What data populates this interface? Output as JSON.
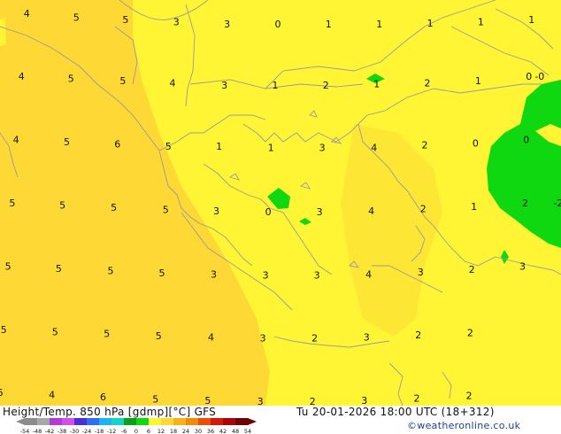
{
  "map": {
    "colors": {
      "warm_yellow": "#fed936",
      "yellow": "#fff534",
      "green": "#10d810",
      "border": "#9b9b9b"
    },
    "temperature_labels": [
      {
        "value": "4",
        "lon": 20.05,
        "lat": 44.2
      },
      {
        "value": "5",
        "lon": 20.98,
        "lat": 44.1
      },
      {
        "value": "5",
        "lon": 21.9,
        "lat": 44.05
      },
      {
        "value": "3",
        "lon": 22.85,
        "lat": 44.0
      },
      {
        "value": "3",
        "lon": 23.8,
        "lat": 43.95
      },
      {
        "value": "0",
        "lon": 24.75,
        "lat": 43.95
      },
      {
        "value": "1",
        "lon": 25.7,
        "lat": 43.95
      },
      {
        "value": "1",
        "lon": 26.65,
        "lat": 43.95
      },
      {
        "value": "1",
        "lon": 27.6,
        "lat": 43.97
      },
      {
        "value": "1",
        "lon": 28.55,
        "lat": 44.0
      },
      {
        "value": "1",
        "lon": 29.5,
        "lat": 44.05
      },
      {
        "value": "4",
        "lon": 19.95,
        "lat": 42.75
      },
      {
        "value": "5",
        "lon": 20.88,
        "lat": 42.7
      },
      {
        "value": "5",
        "lon": 21.85,
        "lat": 42.65
      },
      {
        "value": "4",
        "lon": 22.78,
        "lat": 42.6
      },
      {
        "value": "3",
        "lon": 23.75,
        "lat": 42.55
      },
      {
        "value": "1",
        "lon": 24.7,
        "lat": 42.55
      },
      {
        "value": "2",
        "lon": 25.65,
        "lat": 42.55
      },
      {
        "value": "1",
        "lon": 26.6,
        "lat": 42.58
      },
      {
        "value": "2",
        "lon": 27.55,
        "lat": 42.6
      },
      {
        "value": "1",
        "lon": 28.5,
        "lat": 42.65
      },
      {
        "value": "0",
        "lon": 29.45,
        "lat": 42.75
      },
      {
        "value": "4",
        "lon": 19.85,
        "lat": 41.3
      },
      {
        "value": "5",
        "lon": 20.8,
        "lat": 41.25
      },
      {
        "value": "6",
        "lon": 21.75,
        "lat": 41.2
      },
      {
        "value": "5",
        "lon": 22.7,
        "lat": 41.15
      },
      {
        "value": "1",
        "lon": 23.65,
        "lat": 41.15
      },
      {
        "value": "1",
        "lon": 24.62,
        "lat": 41.12
      },
      {
        "value": "3",
        "lon": 25.58,
        "lat": 41.12
      },
      {
        "value": "4",
        "lon": 26.55,
        "lat": 41.12
      },
      {
        "value": "2",
        "lon": 27.5,
        "lat": 41.18
      },
      {
        "value": "0",
        "lon": 28.45,
        "lat": 41.22
      },
      {
        "value": "0",
        "lon": 29.4,
        "lat": 41.3
      },
      {
        "value": "5",
        "lon": 19.78,
        "lat": 39.85
      },
      {
        "value": "5",
        "lon": 20.72,
        "lat": 39.8
      },
      {
        "value": "5",
        "lon": 21.68,
        "lat": 39.75
      },
      {
        "value": "5",
        "lon": 22.65,
        "lat": 39.7
      },
      {
        "value": "3",
        "lon": 23.6,
        "lat": 39.67
      },
      {
        "value": "0",
        "lon": 24.57,
        "lat": 39.65
      },
      {
        "value": "3",
        "lon": 25.53,
        "lat": 39.65
      },
      {
        "value": "4",
        "lon": 26.5,
        "lat": 39.67
      },
      {
        "value": "2",
        "lon": 27.47,
        "lat": 39.72
      },
      {
        "value": "1",
        "lon": 28.42,
        "lat": 39.77
      },
      {
        "value": "2",
        "lon": 29.38,
        "lat": 39.85
      },
      {
        "value": "5",
        "lon": 19.7,
        "lat": 38.4
      },
      {
        "value": "5",
        "lon": 20.65,
        "lat": 38.35
      },
      {
        "value": "5",
        "lon": 21.62,
        "lat": 38.3
      },
      {
        "value": "5",
        "lon": 22.58,
        "lat": 38.25
      },
      {
        "value": "3",
        "lon": 23.55,
        "lat": 38.22
      },
      {
        "value": "3",
        "lon": 24.52,
        "lat": 38.2
      },
      {
        "value": "3",
        "lon": 25.48,
        "lat": 38.2
      },
      {
        "value": "4",
        "lon": 26.45,
        "lat": 38.22
      },
      {
        "value": "3",
        "lon": 27.42,
        "lat": 38.27
      },
      {
        "value": "2",
        "lon": 28.38,
        "lat": 38.33
      },
      {
        "value": "3",
        "lon": 29.33,
        "lat": 38.4
      },
      {
        "value": "5",
        "lon": 19.62,
        "lat": 36.95
      },
      {
        "value": "5",
        "lon": 20.58,
        "lat": 36.9
      },
      {
        "value": "5",
        "lon": 21.55,
        "lat": 36.85
      },
      {
        "value": "5",
        "lon": 22.52,
        "lat": 36.8
      },
      {
        "value": "4",
        "lon": 23.5,
        "lat": 36.77
      },
      {
        "value": "3",
        "lon": 24.47,
        "lat": 36.75
      },
      {
        "value": "2",
        "lon": 25.44,
        "lat": 36.75
      },
      {
        "value": "3",
        "lon": 26.41,
        "lat": 36.77
      },
      {
        "value": "2",
        "lon": 27.38,
        "lat": 36.82
      },
      {
        "value": "2",
        "lon": 28.35,
        "lat": 36.88
      },
      {
        "value": "6",
        "lon": 19.55,
        "lat": 35.5
      },
      {
        "value": "4",
        "lon": 20.52,
        "lat": 35.45
      },
      {
        "value": "6",
        "lon": 21.48,
        "lat": 35.4
      },
      {
        "value": "5",
        "lon": 22.46,
        "lat": 35.35
      },
      {
        "value": "5",
        "lon": 23.44,
        "lat": 35.32
      },
      {
        "value": "3",
        "lon": 24.42,
        "lat": 35.3
      },
      {
        "value": "2",
        "lon": 25.4,
        "lat": 35.3
      },
      {
        "value": "3",
        "lon": 26.37,
        "lat": 35.32
      },
      {
        "value": "2",
        "lon": 27.35,
        "lat": 35.37
      },
      {
        "value": "2",
        "lon": 28.33,
        "lat": 35.43
      }
    ],
    "partial_labels": [
      {
        "value": "-0",
        "lon": 29.45,
        "lat": 42.75
      },
      {
        "value": "-2",
        "lon": 29.8,
        "lat": 39.85
      }
    ]
  },
  "footer": {
    "title": "Height/Temp. 850 hPa [gdmp][°C] GFS",
    "datetime": "Tu 20-01-2026 18:00 UTC (18+312)",
    "credit": "©weatheronline.co.uk"
  },
  "scale": {
    "ticks": [
      "-54",
      "-48",
      "-42",
      "-38",
      "-30",
      "-24",
      "-18",
      "-12",
      "-6",
      "0",
      "6",
      "12",
      "18",
      "24",
      "30",
      "36",
      "42",
      "48",
      "54"
    ],
    "colors": [
      "#8c8c8c",
      "#a8a8a8",
      "#b23bd6",
      "#d44fe6",
      "#4a2fd8",
      "#2d6ff0",
      "#1fb1f0",
      "#15d4c8",
      "#0aa01a",
      "#10d810",
      "#fff534",
      "#fed936",
      "#f7b21c",
      "#f08a0a",
      "#e8500a",
      "#d11a0a",
      "#a8070a",
      "#6d0506"
    ]
  }
}
